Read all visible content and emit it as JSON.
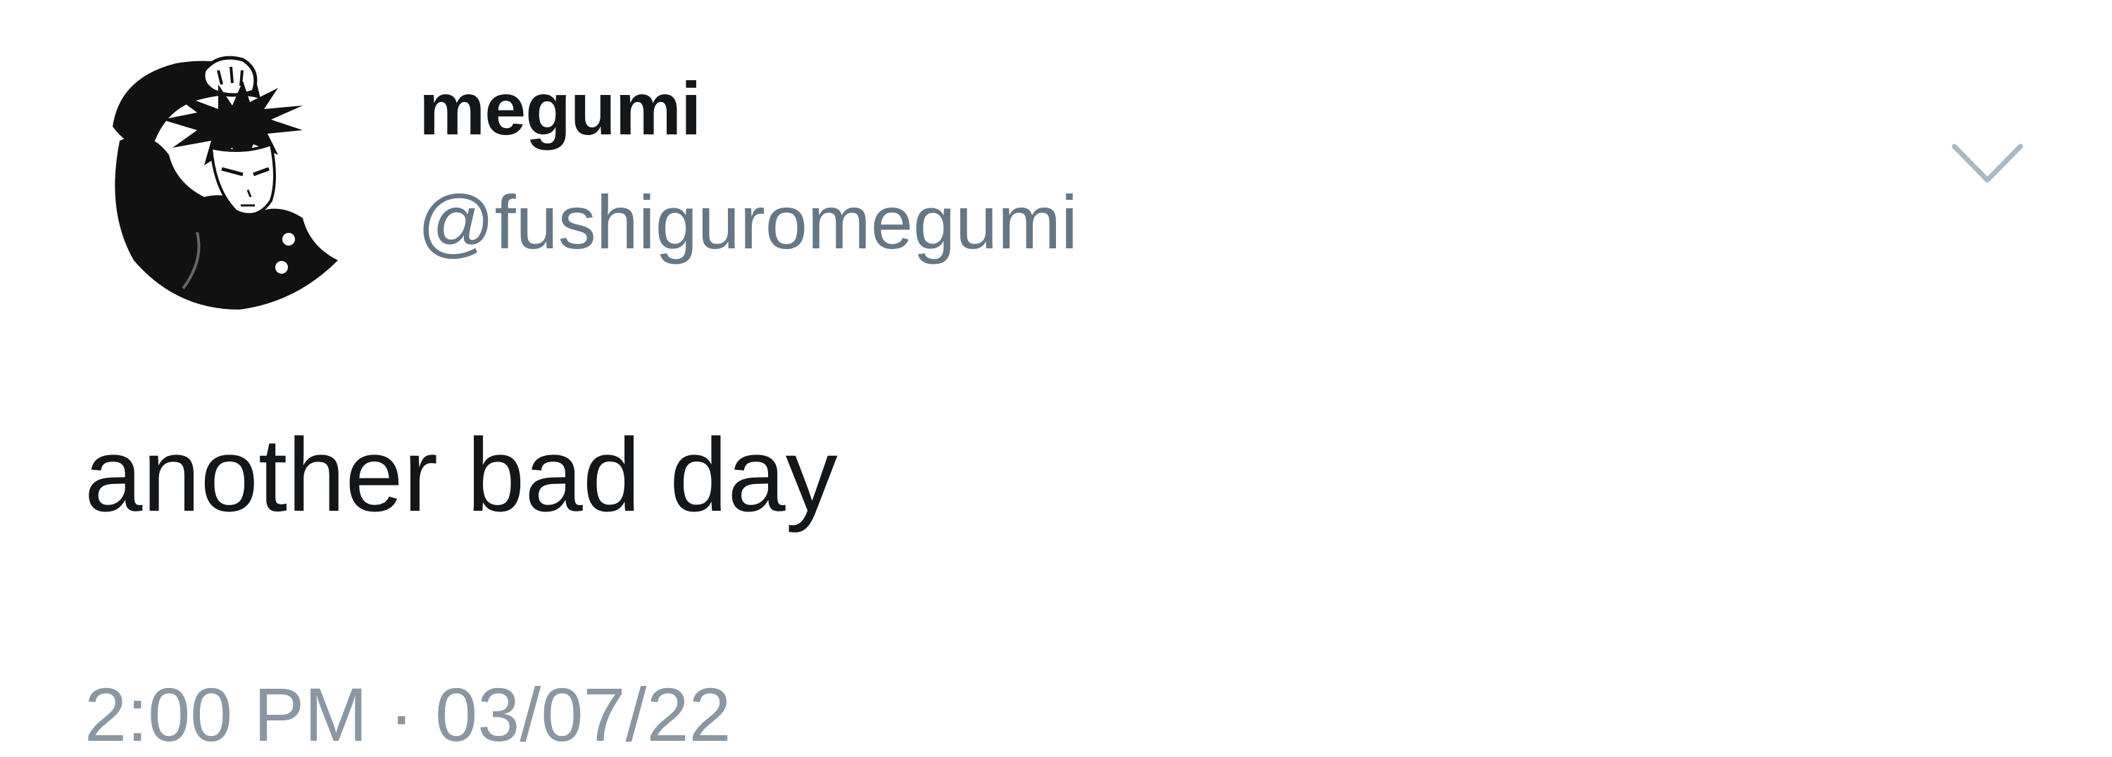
{
  "user": {
    "display_name": "megumi",
    "handle": "@fushiguromegumi"
  },
  "tweet": {
    "text": "another bad day",
    "timestamp": "2:00 PM · 03/07/22"
  },
  "icons": {
    "menu": "chevron-down-icon",
    "avatar": "avatar-image"
  },
  "colors": {
    "text_primary": "#14171a",
    "text_secondary": "#657786",
    "chevron": "#aab8c2",
    "background": "#ffffff"
  }
}
